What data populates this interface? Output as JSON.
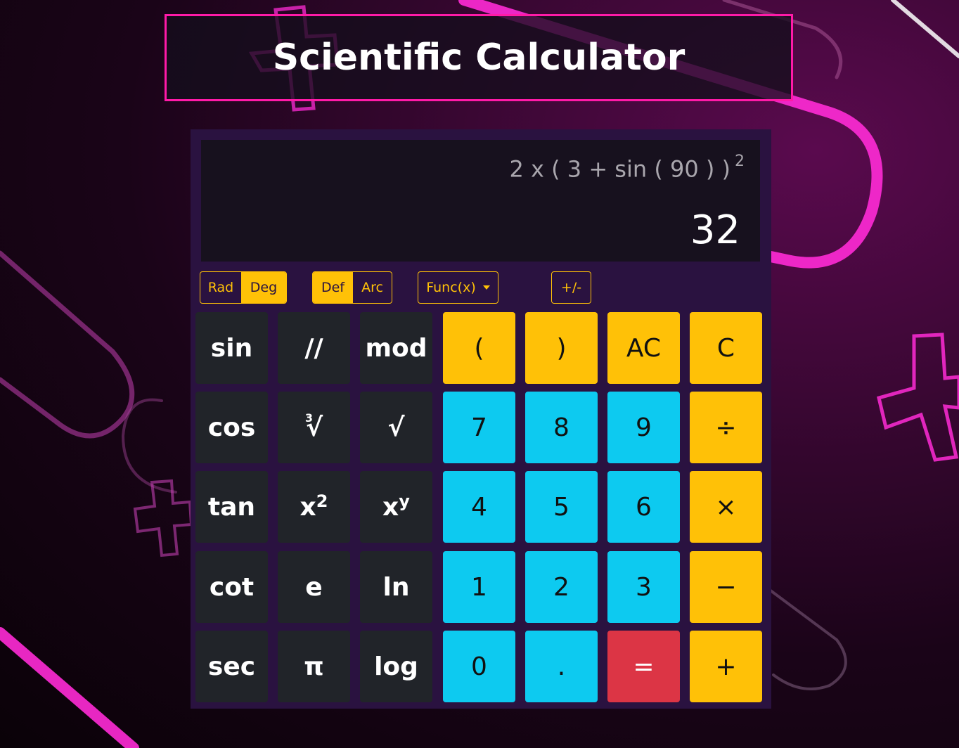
{
  "title": "Scientific Calculator",
  "display": {
    "expression": "2 x ( 3 + sin ( 90 ) )",
    "expression_exponent": "2",
    "result": "32"
  },
  "controls": {
    "angle_mode": {
      "options": [
        "Rad",
        "Deg"
      ],
      "selected": "Deg"
    },
    "function_mode": {
      "options": [
        "Def",
        "Arc"
      ],
      "selected": "Def"
    },
    "func_dropdown": "Func(x)",
    "sign_toggle": "+/-"
  },
  "keys": {
    "sin": "sin",
    "floor_div": "//",
    "mod": "mod",
    "open_paren": "(",
    "close_paren": ")",
    "ac": "AC",
    "c": "C",
    "cos": "cos",
    "cbrt_index": "3",
    "cbrt": "√",
    "sqrt": "√",
    "seven": "7",
    "eight": "8",
    "nine": "9",
    "divide": "÷",
    "tan": "tan",
    "x_square_base": "x",
    "x_square_exp": "2",
    "x_pow_base": "x",
    "x_pow_exp": "y",
    "four": "4",
    "five": "5",
    "six": "6",
    "multiply": "×",
    "cot": "cot",
    "e": "e",
    "ln": "ln",
    "one": "1",
    "two": "2",
    "three": "3",
    "minus": "−",
    "sec": "sec",
    "pi": "π",
    "log": "log",
    "zero": "0",
    "dot": ".",
    "equals": "=",
    "plus": "+"
  },
  "colors": {
    "accent_border": "#ff1aa8",
    "panel": "#2a1240",
    "dark_key": "#212429",
    "yellow_key": "#ffc107",
    "cyan_key": "#0dcaf0",
    "red_key": "#dc3545"
  }
}
